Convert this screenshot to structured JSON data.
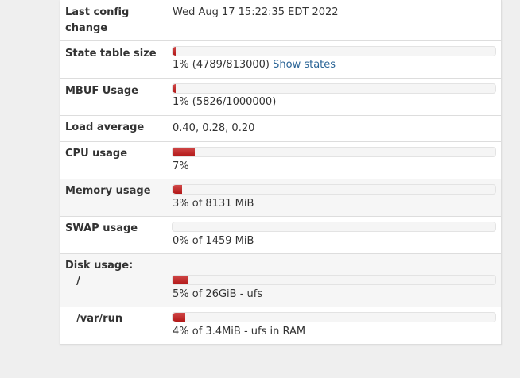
{
  "accent_color": "#b21818",
  "rows": {
    "last_config": {
      "label_line1": "Last config",
      "label_line2": "change",
      "value": "Wed Aug 17 15:22:35 EDT 2022"
    },
    "state_table": {
      "label": "State table size",
      "percent": 1,
      "detail": "1% (4789/813000)",
      "link": "Show states"
    },
    "mbuf": {
      "label": "MBUF Usage",
      "percent": 1,
      "detail": "1% (5826/1000000)"
    },
    "load_average": {
      "label": "Load average",
      "value": "0.40, 0.28, 0.20"
    },
    "cpu": {
      "label": "CPU usage",
      "percent": 7,
      "detail": "7%"
    },
    "memory": {
      "label": "Memory usage",
      "percent": 3,
      "detail": "3% of 8131 MiB"
    },
    "swap": {
      "label": "SWAP usage",
      "percent": 0,
      "detail": "0% of 1459 MiB"
    },
    "disk": {
      "label": "Disk usage:",
      "root": {
        "mount": "/",
        "percent": 5,
        "detail": "5% of 26GiB - ufs"
      },
      "varrun": {
        "mount": "/var/run",
        "percent": 4,
        "detail": "4% of 3.4MiB - ufs in RAM"
      }
    }
  }
}
